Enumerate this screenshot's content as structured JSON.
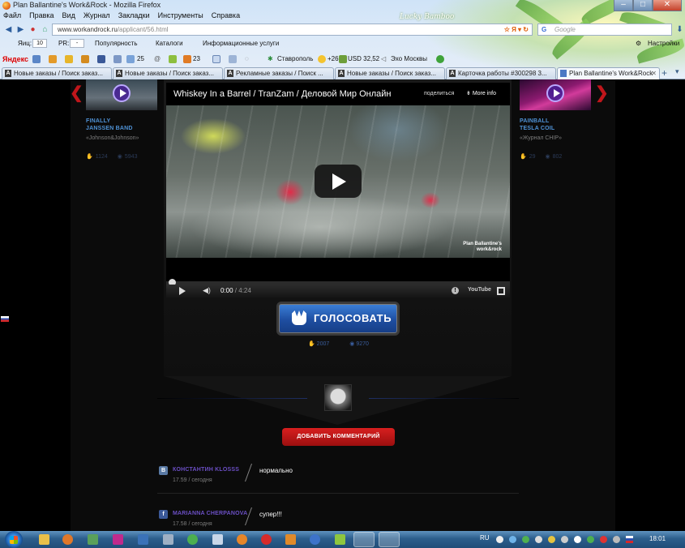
{
  "window": {
    "title": "Plan Ballantine's Work&Rock - Mozilla Firefox",
    "skin_text": "Lucky Bamboo"
  },
  "menu": [
    "Файл",
    "Правка",
    "Вид",
    "Журнал",
    "Закладки",
    "Инструменты",
    "Справка"
  ],
  "nav": {
    "url_host": "www.workandrock.ru",
    "url_path": "/applicant/56.html",
    "search_placeholder": "Google"
  },
  "toolbar1": {
    "yandex_ic_label": "Яиц:",
    "yandex_ic_value": "10",
    "pr_label": "PR:",
    "pr_value": "-",
    "popularity": "Популярность",
    "catalogs": "Каталоги",
    "info_services": "Информационные услуги",
    "settings": "Настройки"
  },
  "toolbar2": {
    "yandex": "Яндекс",
    "count1": "25",
    "count2": "23",
    "city": "Ставрополь",
    "temp": "+26",
    "usd": "USD 32,52",
    "radio": "Эхо Москвы"
  },
  "tabs": [
    {
      "label": "Новые заказы / Поиск заказ...",
      "fav": "A"
    },
    {
      "label": "Новые заказы / Поиск заказ...",
      "fav": "A"
    },
    {
      "label": "Рекламные заказы / Поиск ...",
      "fav": "A"
    },
    {
      "label": "Новые заказы / Поиск заказ...",
      "fav": "A"
    },
    {
      "label": "Карточка работы #300298 3...",
      "fav": "A"
    },
    {
      "label": "Plan Ballantine's Work&Rock",
      "fav": "",
      "active": true
    }
  ],
  "left_card": {
    "band_line1": "FINALLY",
    "band_line2": "JANSSEN BAND",
    "client": "«Johnson&Johnson»",
    "votes": "1124",
    "views": "5943"
  },
  "right_card": {
    "band_line1": "PAINBALL",
    "band_line2": "TESLA COIL",
    "client": "«Журнал CHIP»",
    "votes": "29",
    "views": "802"
  },
  "player": {
    "title": "Whiskey In a Barrel / TranZam / Деловой Мир Онлайн",
    "share": "поделиться",
    "more_info": "More info",
    "watermark_line1": "Plan Ballantine's",
    "watermark_line2": "work&rock",
    "time_current": "0:00",
    "time_total": "4:24",
    "youtube": "YouTube",
    "progress_fraction": 0.0
  },
  "vote": {
    "button_label": "ГОЛОСОВАТЬ",
    "votes": "2007",
    "views": "9270"
  },
  "comments_section": {
    "add_comment_label": "ДОБАВИТЬ КОММЕНТАРИЙ",
    "comments": [
      {
        "network": "vk",
        "network_letter": "В",
        "author": "КОНСТАНТИН KLOSSS",
        "when": "17.59 / сегодня",
        "text": "нормально"
      },
      {
        "network": "facebook",
        "network_letter": "f",
        "author": "MARIANNA CHERPANOVA",
        "when": "17.58 / сегодня",
        "text": "супер!!!"
      }
    ]
  },
  "taskbar": {
    "lang": "RU",
    "clock": "18:01"
  },
  "colors": {
    "page_bg": "#000000",
    "accent_red": "#c0161b",
    "vote_blue": "#1e4ea1",
    "band_blue": "#4f92d6",
    "author_purple": "#6b4fc4"
  }
}
